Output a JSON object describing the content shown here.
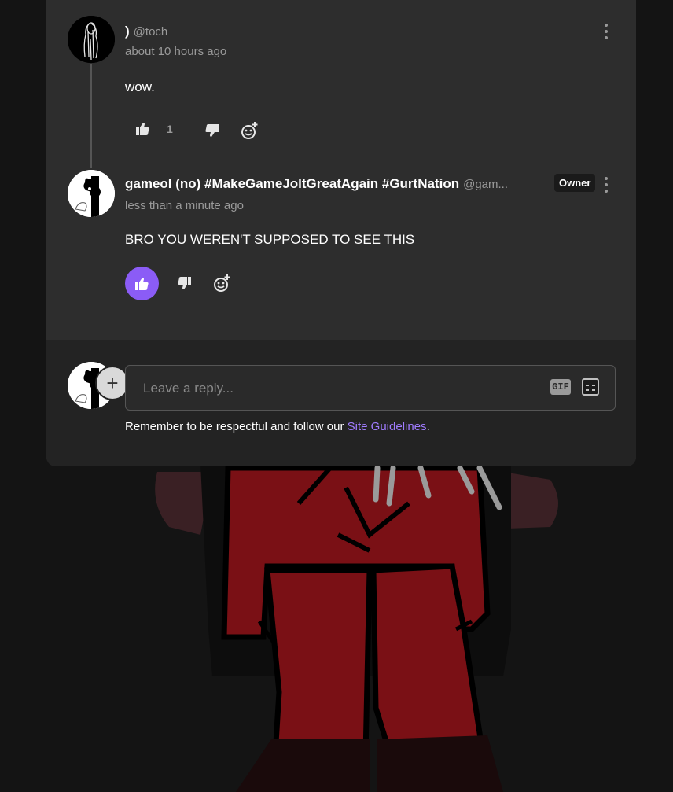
{
  "comments": [
    {
      "display_name": ")",
      "handle": "@toch",
      "timestamp": "about 10 hours ago",
      "body": "wow.",
      "like_count": "1",
      "avatar_icon": "sketch-figure-avatar"
    },
    {
      "display_name": "gameol (no) #MakeGameJoltGreatAgain #GurtNation",
      "handle": "@gam...",
      "badge": "Owner",
      "timestamp": "less than a minute ago",
      "body": "BRO YOU WEREN'T SUPPOSED TO SEE THIS",
      "liked": true,
      "avatar_icon": "black-white-character-avatar"
    }
  ],
  "reply": {
    "placeholder": "Leave a reply...",
    "gif_label": "GIF",
    "guidelines_prefix": "Remember to be respectful and follow our ",
    "guidelines_link": "Site Guidelines",
    "guidelines_suffix": "."
  },
  "colors": {
    "accent": "#8b5cf6",
    "link": "#a07cff",
    "panel": "#2d2d2d",
    "reply_area": "#232323"
  }
}
